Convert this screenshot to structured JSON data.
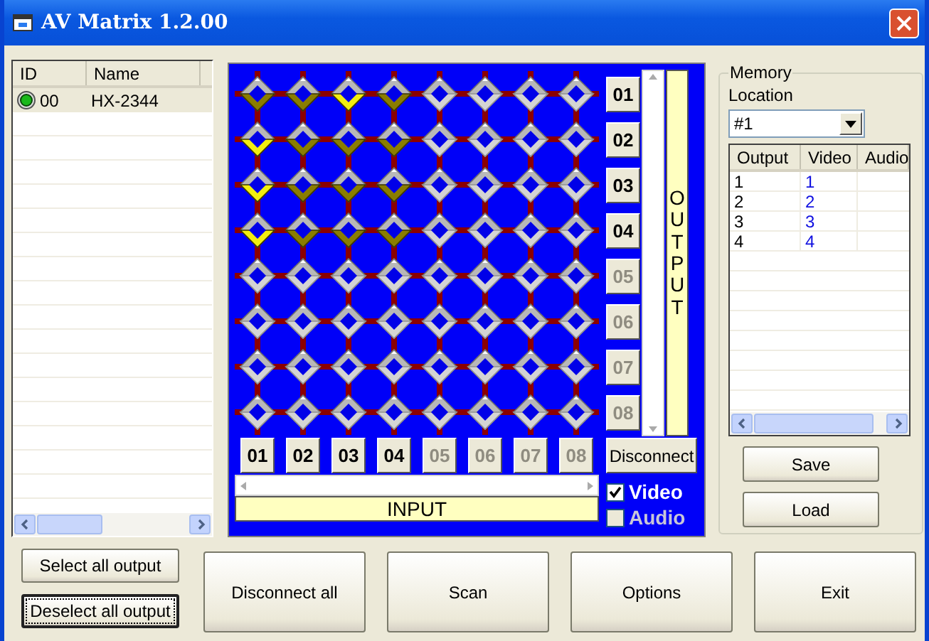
{
  "window": {
    "title": "AV Matrix 1.2.00"
  },
  "device_list": {
    "columns": [
      "ID",
      "Name"
    ],
    "rows": [
      {
        "id": "00",
        "name": "HX-2344",
        "online": true,
        "selected": true
      }
    ]
  },
  "matrix": {
    "rows": [
      {
        "cells": [
          {
            "connected": true,
            "highlighted": false
          },
          {
            "connected": true,
            "highlighted": false
          },
          {
            "connected": true,
            "highlighted": true
          },
          {
            "connected": true,
            "highlighted": false
          },
          {
            "connected": false,
            "highlighted": false
          },
          {
            "connected": false,
            "highlighted": false
          },
          {
            "connected": false,
            "highlighted": false
          },
          {
            "connected": false,
            "highlighted": false
          }
        ]
      },
      {
        "cells": [
          {
            "connected": true,
            "highlighted": true
          },
          {
            "connected": true,
            "highlighted": false
          },
          {
            "connected": true,
            "highlighted": false
          },
          {
            "connected": true,
            "highlighted": false
          },
          {
            "connected": false,
            "highlighted": false
          },
          {
            "connected": false,
            "highlighted": false
          },
          {
            "connected": false,
            "highlighted": false
          },
          {
            "connected": false,
            "highlighted": false
          }
        ]
      },
      {
        "cells": [
          {
            "connected": true,
            "highlighted": true
          },
          {
            "connected": true,
            "highlighted": false
          },
          {
            "connected": true,
            "highlighted": false
          },
          {
            "connected": true,
            "highlighted": false
          },
          {
            "connected": false,
            "highlighted": false
          },
          {
            "connected": false,
            "highlighted": false
          },
          {
            "connected": false,
            "highlighted": false
          },
          {
            "connected": false,
            "highlighted": false
          }
        ]
      },
      {
        "cells": [
          {
            "connected": true,
            "highlighted": true
          },
          {
            "connected": true,
            "highlighted": false
          },
          {
            "connected": true,
            "highlighted": false
          },
          {
            "connected": true,
            "highlighted": false
          },
          {
            "connected": false,
            "highlighted": false
          },
          {
            "connected": false,
            "highlighted": false
          },
          {
            "connected": false,
            "highlighted": false
          },
          {
            "connected": false,
            "highlighted": false
          }
        ]
      },
      {
        "cells": [
          {
            "connected": false,
            "highlighted": false
          },
          {
            "connected": false,
            "highlighted": false
          },
          {
            "connected": false,
            "highlighted": false
          },
          {
            "connected": false,
            "highlighted": false
          },
          {
            "connected": false,
            "highlighted": false
          },
          {
            "connected": false,
            "highlighted": false
          },
          {
            "connected": false,
            "highlighted": false
          },
          {
            "connected": false,
            "highlighted": false
          }
        ]
      },
      {
        "cells": [
          {
            "connected": false,
            "highlighted": false
          },
          {
            "connected": false,
            "highlighted": false
          },
          {
            "connected": false,
            "highlighted": false
          },
          {
            "connected": false,
            "highlighted": false
          },
          {
            "connected": false,
            "highlighted": false
          },
          {
            "connected": false,
            "highlighted": false
          },
          {
            "connected": false,
            "highlighted": false
          },
          {
            "connected": false,
            "highlighted": false
          }
        ]
      },
      {
        "cells": [
          {
            "connected": false,
            "highlighted": false
          },
          {
            "connected": false,
            "highlighted": false
          },
          {
            "connected": false,
            "highlighted": false
          },
          {
            "connected": false,
            "highlighted": false
          },
          {
            "connected": false,
            "highlighted": false
          },
          {
            "connected": false,
            "highlighted": false
          },
          {
            "connected": false,
            "highlighted": false
          },
          {
            "connected": false,
            "highlighted": false
          }
        ]
      },
      {
        "cells": [
          {
            "connected": false,
            "highlighted": false
          },
          {
            "connected": false,
            "highlighted": false
          },
          {
            "connected": false,
            "highlighted": false
          },
          {
            "connected": false,
            "highlighted": false
          },
          {
            "connected": false,
            "highlighted": false
          },
          {
            "connected": false,
            "highlighted": false
          },
          {
            "connected": false,
            "highlighted": false
          },
          {
            "connected": false,
            "highlighted": false
          }
        ]
      }
    ],
    "outputs": [
      {
        "label": "01",
        "enabled": true
      },
      {
        "label": "02",
        "enabled": true
      },
      {
        "label": "03",
        "enabled": true
      },
      {
        "label": "04",
        "enabled": true
      },
      {
        "label": "05",
        "enabled": false
      },
      {
        "label": "06",
        "enabled": false
      },
      {
        "label": "07",
        "enabled": false
      },
      {
        "label": "08",
        "enabled": false
      }
    ],
    "inputs": [
      {
        "label": "01",
        "enabled": true
      },
      {
        "label": "02",
        "enabled": true
      },
      {
        "label": "03",
        "enabled": true
      },
      {
        "label": "04",
        "enabled": true
      },
      {
        "label": "05",
        "enabled": false
      },
      {
        "label": "06",
        "enabled": false
      },
      {
        "label": "07",
        "enabled": false
      },
      {
        "label": "08",
        "enabled": false
      }
    ],
    "output_caption": "OUTPUT",
    "input_caption": "INPUT",
    "disconnect": "Disconnect",
    "options": [
      {
        "label": "Video",
        "checked": true,
        "disabled": false
      },
      {
        "label": "Audio",
        "checked": false,
        "disabled": true
      }
    ]
  },
  "memory": {
    "title": "Memory",
    "location_label": "Location",
    "location": "#1",
    "columns": [
      "Output",
      "Video",
      "Audio"
    ],
    "rows": [
      {
        "output": "1",
        "video": "1"
      },
      {
        "output": "2",
        "video": "2"
      },
      {
        "output": "3",
        "video": "3"
      },
      {
        "output": "4",
        "video": "4"
      }
    ],
    "save": "Save",
    "load": "Load"
  },
  "output_buttons": [
    {
      "label": "Select all output",
      "focused": false
    },
    {
      "label": "Deselect all output",
      "focused": true
    }
  ],
  "buttons": [
    "Disconnect all",
    "Scan",
    "Options",
    "Exit"
  ]
}
